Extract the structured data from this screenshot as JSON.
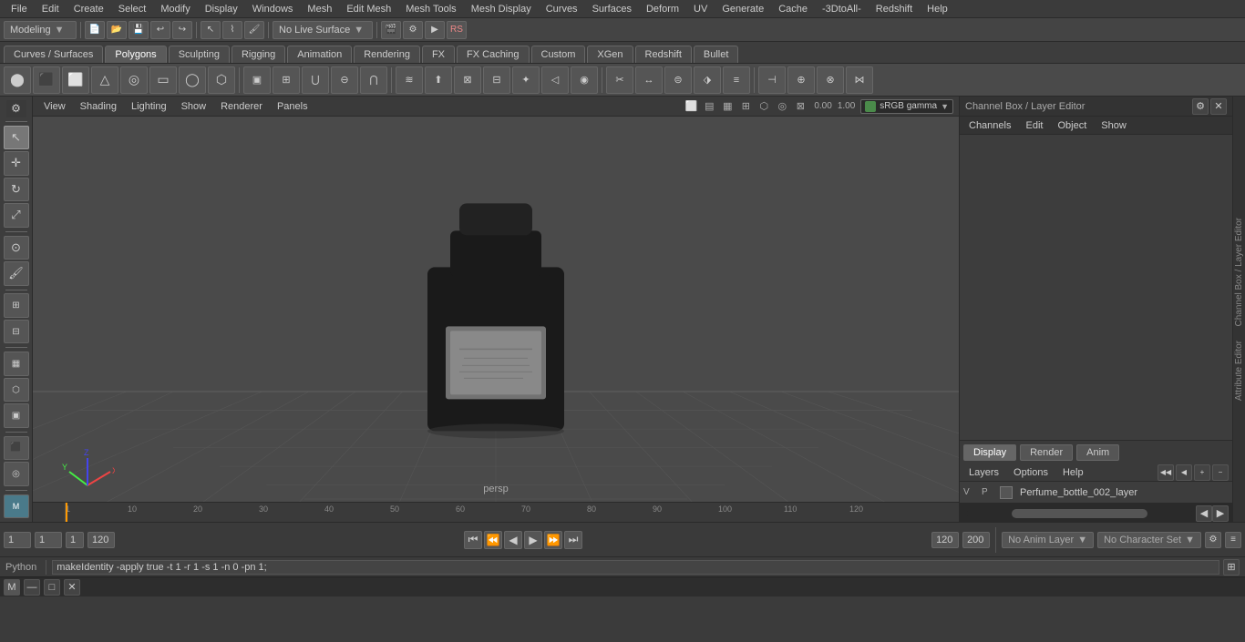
{
  "menubar": {
    "items": [
      "File",
      "Edit",
      "Create",
      "Select",
      "Modify",
      "Display",
      "Windows",
      "Mesh",
      "Edit Mesh",
      "Mesh Tools",
      "Mesh Display",
      "Curves",
      "Surfaces",
      "Deform",
      "UV",
      "Generate",
      "Cache",
      "-3DtoAll-",
      "Redshift",
      "Help"
    ]
  },
  "toolbar1": {
    "workspace_label": "Modeling",
    "live_surface_label": "No Live Surface"
  },
  "shelf": {
    "tabs": [
      "Curves / Surfaces",
      "Polygons",
      "Sculpting",
      "Rigging",
      "Animation",
      "Rendering",
      "FX",
      "FX Caching",
      "Custom",
      "XGen",
      "Redshift",
      "Bullet"
    ],
    "active_tab": "Polygons"
  },
  "viewport": {
    "camera_label": "persp",
    "menus": [
      "View",
      "Shading",
      "Lighting",
      "Show",
      "Renderer",
      "Panels"
    ],
    "gamma_value": "0.00",
    "gamma_val2": "1.00",
    "color_space": "sRGB gamma"
  },
  "right_panel": {
    "title": "Channel Box / Layer Editor",
    "channels_tab": "Channels",
    "edit_tab": "Edit",
    "object_tab": "Object",
    "show_tab": "Show",
    "display_tab": "Display",
    "render_tab": "Render",
    "anim_tab": "Anim",
    "layers_menu": [
      "Layers",
      "Options",
      "Help"
    ],
    "layer_row": {
      "v": "V",
      "p": "P",
      "name": "Perfume_bottle_002_layer"
    }
  },
  "timeline": {
    "start": "1",
    "end": "120",
    "current": "1",
    "range_start": "1",
    "range_end": "120",
    "max_end": "200",
    "marks": [
      "1",
      "10",
      "20",
      "30",
      "40",
      "50",
      "60",
      "70",
      "80",
      "90",
      "100",
      "110",
      "120"
    ]
  },
  "bottom_controls": {
    "frame_field": "1",
    "field2": "1",
    "field3": "1",
    "range_end": "120",
    "range_end2": "120",
    "max_end": "200",
    "anim_layer_label": "No Anim Layer",
    "char_set_label": "No Character Set"
  },
  "status_bar": {
    "python_label": "Python",
    "command": "makeIdentity -apply true -t 1 -r 1 -s 1 -n 0 -pn 1;"
  },
  "bottom_window": {
    "window_label": ""
  },
  "icons": {
    "select": "↖",
    "move": "✛",
    "rotate": "↻",
    "scale": "⤢",
    "settings": "⚙",
    "play": "▶",
    "stop": "■",
    "prev": "⏮",
    "next": "⏭",
    "step_back": "⏪",
    "step_fwd": "⏩",
    "close": "✕",
    "minimize": "—",
    "maximize": "□"
  }
}
